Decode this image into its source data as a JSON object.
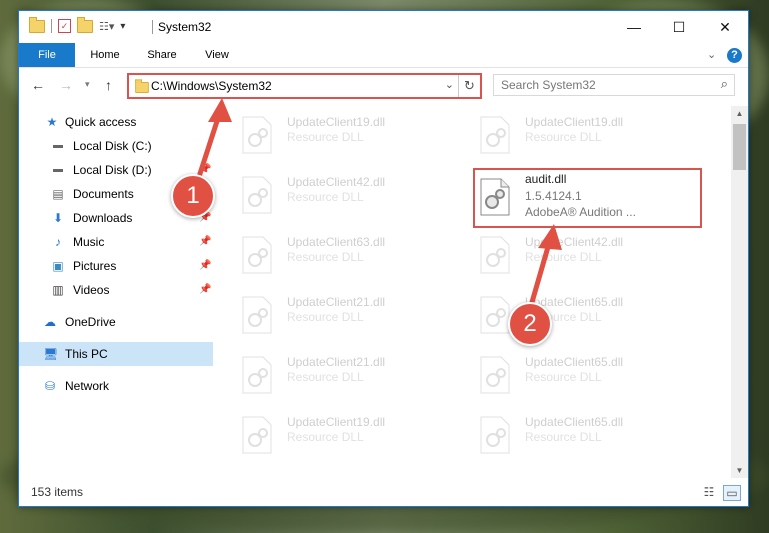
{
  "window": {
    "title": "System32"
  },
  "ribbon": {
    "tabs": [
      "File",
      "Home",
      "Share",
      "View"
    ]
  },
  "address": {
    "path": "C:\\Windows\\System32",
    "search_placeholder": "Search System32"
  },
  "sidebar": {
    "items": [
      {
        "label": "Quick access",
        "icon": "star-icon"
      },
      {
        "label": "Local Disk (C:)",
        "icon": "drive-icon"
      },
      {
        "label": "Local Disk (D:)",
        "icon": "drive-icon"
      },
      {
        "label": "Documents",
        "icon": "document-icon"
      },
      {
        "label": "Downloads",
        "icon": "download-icon"
      },
      {
        "label": "Music",
        "icon": "music-icon"
      },
      {
        "label": "Pictures",
        "icon": "pictures-icon"
      },
      {
        "label": "Videos",
        "icon": "video-icon"
      },
      {
        "label": "OneDrive",
        "icon": "cloud-icon"
      },
      {
        "label": "This PC",
        "icon": "computer-icon"
      },
      {
        "label": "Network",
        "icon": "network-icon"
      }
    ]
  },
  "files": {
    "left": [
      {
        "name": "UpdateClient19.dll",
        "type": "Resource DLL"
      },
      {
        "name": "UpdateClient42.dll",
        "type": "Resource DLL"
      },
      {
        "name": "UpdateClient63.dll",
        "type": "Resource DLL"
      },
      {
        "name": "UpdateClient21.dll",
        "type": "Resource DLL"
      },
      {
        "name": "UpdateClient21.dll",
        "type": "Resource DLL"
      },
      {
        "name": "UpdateClient19.dll",
        "type": "Resource DLL"
      }
    ],
    "right": [
      {
        "name": "UpdateClient19.dll",
        "type": "Resource DLL"
      },
      {
        "name": "UpdateClient42.dll",
        "type": "Resource DLL"
      },
      {
        "name": "UpdateClient65.dll",
        "type": "Resource DLL"
      },
      {
        "name": "UpdateClient65.dll",
        "type": "Resource DLL"
      },
      {
        "name": "UpdateClient65.dll",
        "type": "Resource DLL"
      }
    ],
    "highlighted": {
      "name": "audit.dll",
      "version": "1.5.4124.1",
      "description": "AdobeA® Audition ..."
    }
  },
  "status": {
    "items_count": "153 items"
  },
  "annotations": {
    "step1": "1",
    "step2": "2"
  },
  "colors": {
    "accent": "#1979ca",
    "highlight": "#d9534f",
    "selected": "#cce4f7"
  }
}
